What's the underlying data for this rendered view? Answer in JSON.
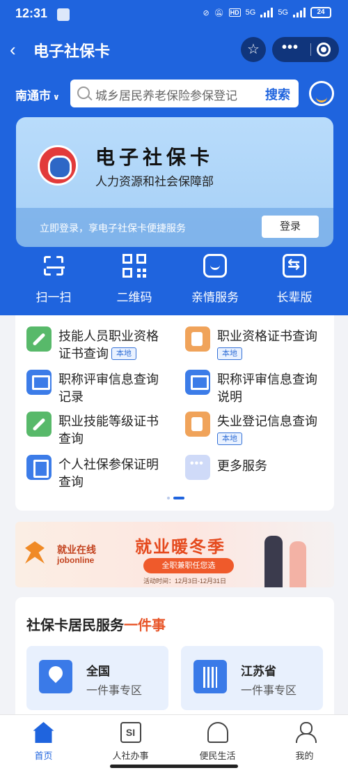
{
  "colors": {
    "primary": "#1f64de",
    "accent": "#e8562a",
    "badge": "#3471d7"
  },
  "status_bar": {
    "time": "12:31",
    "hd": "HD",
    "net1": "5G",
    "net2": "5G",
    "battery": "24"
  },
  "nav": {
    "title": "电子社保卡",
    "back_icon": "chevron-left-icon",
    "star_icon": "star-icon"
  },
  "search": {
    "city": "南通市",
    "placeholder": "城乡居民养老保险参保登记",
    "button": "搜索"
  },
  "card": {
    "title": "电子社保卡",
    "subtitle": "人力资源和社会保障部",
    "tip": "立即登录，享电子社保卡便捷服务",
    "login": "登录"
  },
  "quick_actions": [
    {
      "label": "扫一扫",
      "icon": "scan-icon"
    },
    {
      "label": "二维码",
      "icon": "qrcode-icon"
    },
    {
      "label": "亲情服务",
      "icon": "family-service-icon"
    },
    {
      "label": "长辈版",
      "icon": "elder-mode-icon"
    }
  ],
  "services": [
    {
      "line1": "技能人员职业资格",
      "line2": "证书查询",
      "badge": "本地",
      "icon": "wrench-icon"
    },
    {
      "line1": "职业资格证书查询",
      "line2": "",
      "badge": "本地",
      "icon": "certificate-icon"
    },
    {
      "line1": "职称评审信息查询",
      "line2": "记录",
      "badge": "",
      "icon": "monitor-icon"
    },
    {
      "line1": "职称评审信息查询",
      "line2": "说明",
      "badge": "",
      "icon": "monitor-icon"
    },
    {
      "line1": "职业技能等级证书",
      "line2": "查询",
      "badge": "",
      "icon": "wrench-icon"
    },
    {
      "line1": "失业登记信息查询",
      "line2": "",
      "badge": "本地",
      "icon": "briefcase-icon"
    },
    {
      "line1": "个人社保参保证明",
      "line2": "查询",
      "badge": "",
      "icon": "document-search-icon"
    },
    {
      "line1": "更多服务",
      "line2": "",
      "badge": "",
      "icon": "more-icon"
    }
  ],
  "pager": {
    "pages": 2,
    "current": 2
  },
  "banner": {
    "brand_cn": "就业在线",
    "brand_en": "jobonline",
    "headline": "就业暖冬季",
    "pill": "全职兼职任您选",
    "date": "活动时间：12月3日-12月31日"
  },
  "one_service": {
    "title_main": "社保卡居民服务",
    "title_accent": "一件事",
    "cards": [
      {
        "title": "全国",
        "subtitle": "一件事专区",
        "icon": "location-pin-icon"
      },
      {
        "title": "江苏省",
        "subtitle": "一件事专区",
        "icon": "building-icon"
      }
    ]
  },
  "tabs": [
    {
      "label": "首页",
      "icon": "home-icon",
      "active": true
    },
    {
      "label": "人社办事",
      "icon": "si-icon",
      "active": false,
      "glyph": "SI"
    },
    {
      "label": "便民生活",
      "icon": "handshake-icon",
      "active": false
    },
    {
      "label": "我的",
      "icon": "person-icon",
      "active": false
    }
  ]
}
